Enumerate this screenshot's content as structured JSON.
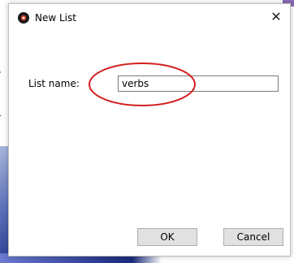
{
  "window": {
    "title": "New List",
    "app_icon": "app-logo-icon",
    "close_glyph": "✕"
  },
  "form": {
    "list_name_label": "List name:",
    "list_name_value": "verbs"
  },
  "buttons": {
    "ok_label": "OK",
    "cancel_label": "Cancel"
  },
  "colors": {
    "annotation": "#d21f1f",
    "icon_fill": "#1a1a1a",
    "icon_accent": "#e0402a"
  }
}
